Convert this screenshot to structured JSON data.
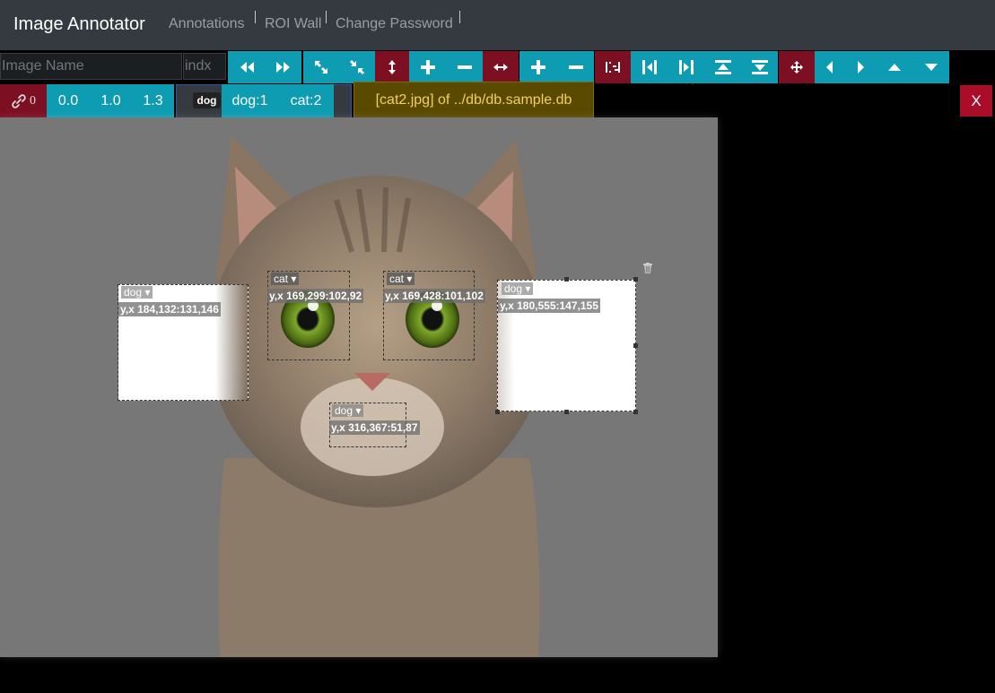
{
  "navbar": {
    "brand": "Image Annotator",
    "links": [
      "Annotations",
      "ROI Wall",
      "Change Password"
    ]
  },
  "toolbar": {
    "image_name_placeholder": "Image Name",
    "index_placeholder": "indx",
    "buttons": [
      {
        "name": "prev-fast-button",
        "icon": "double-left-arrow-icon"
      },
      {
        "name": "next-fast-button",
        "icon": "double-right-arrow-icon"
      },
      {
        "name": "expand-button",
        "icon": "expand-arrows-icon"
      },
      {
        "name": "compress-button",
        "icon": "compress-arrows-icon"
      },
      {
        "name": "vertical-resize-button",
        "icon": "vertical-arrows-icon"
      },
      {
        "name": "increase-height-button",
        "icon": "plus-icon"
      },
      {
        "name": "decrease-height-button",
        "icon": "minus-icon"
      },
      {
        "name": "horizontal-resize-button",
        "icon": "horizontal-arrows-icon"
      },
      {
        "name": "increase-width-button",
        "icon": "plus-icon"
      },
      {
        "name": "decrease-width-button",
        "icon": "minus-icon"
      },
      {
        "name": "align-toggle-button",
        "icon": "align-bracket-icon"
      },
      {
        "name": "align-left-button",
        "icon": "align-left-icon"
      },
      {
        "name": "align-right-button",
        "icon": "align-right-icon"
      },
      {
        "name": "align-top-button",
        "icon": "align-top-icon"
      },
      {
        "name": "align-bottom-button",
        "icon": "align-bottom-icon"
      },
      {
        "name": "move-button",
        "icon": "move-arrows-icon"
      },
      {
        "name": "move-left-button",
        "icon": "caret-left-icon"
      },
      {
        "name": "move-right-button",
        "icon": "caret-right-icon"
      },
      {
        "name": "move-up-button",
        "icon": "caret-up-icon"
      },
      {
        "name": "move-down-button",
        "icon": "caret-down-icon"
      }
    ]
  },
  "row2": {
    "link_count": "0",
    "zoom_values": [
      "0.0",
      "1.0",
      "1.3"
    ],
    "current_label": "dog",
    "label_counts": [
      "dog:1",
      "cat:2"
    ],
    "file_info": "[cat2.jpg] of ../db/db.sample.db",
    "close_label": "X"
  },
  "rois": [
    {
      "label": "dog",
      "coords": "y,x 184,132:131,146"
    },
    {
      "label": "cat",
      "coords": "y,x 169,299:102,92"
    },
    {
      "label": "cat",
      "coords": "y,x 169,428:101,102"
    },
    {
      "label": "dog",
      "coords": "y,x 180,555:147,155"
    },
    {
      "label": "dog",
      "coords": "y,x 316,367:51,87"
    }
  ],
  "colors": {
    "navbar": "#343a40",
    "teal": "#0e9cb3",
    "dark_red": "#7c0f22",
    "file_info_bg": "#5a4a00",
    "file_info_text": "#f0d060"
  }
}
